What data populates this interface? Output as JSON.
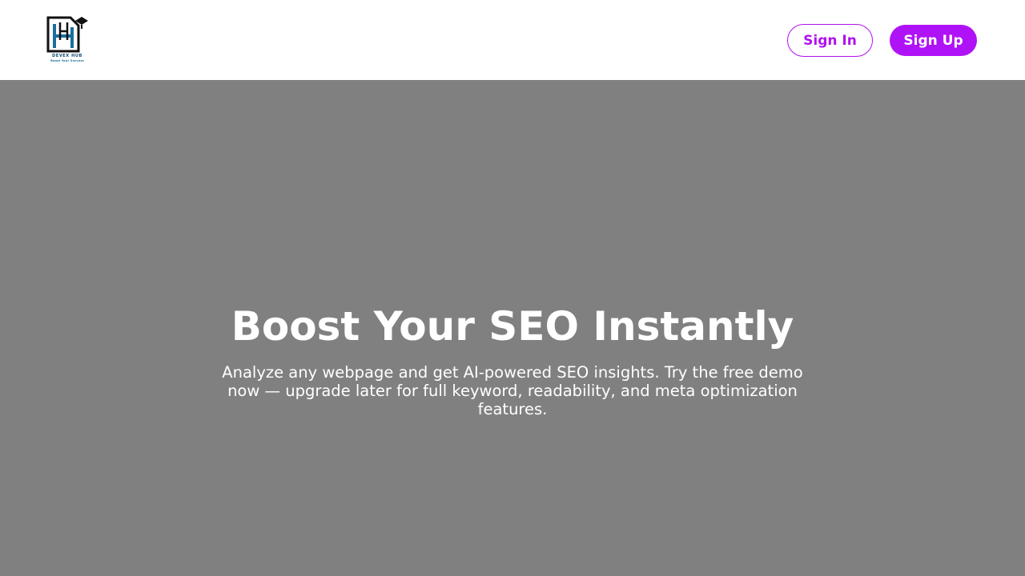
{
  "brand": {
    "logo_text": "DEVEX HUB",
    "logo_tagline": "Boost Your Success",
    "icon": "devex-hub-logo-icon",
    "colors": {
      "dark": "#111111",
      "blue": "#1a6e9e"
    }
  },
  "nav": {
    "sign_in_label": "Sign In",
    "sign_up_label": "Sign Up",
    "accent_color": "#b012f7"
  },
  "hero": {
    "title": "Boost Your SEO Instantly",
    "subtitle": "Analyze any webpage and get AI-powered SEO insights. Try the free demo now — upgrade later for full keyword, readability, and meta optimization features.",
    "background_color": "#808080"
  }
}
